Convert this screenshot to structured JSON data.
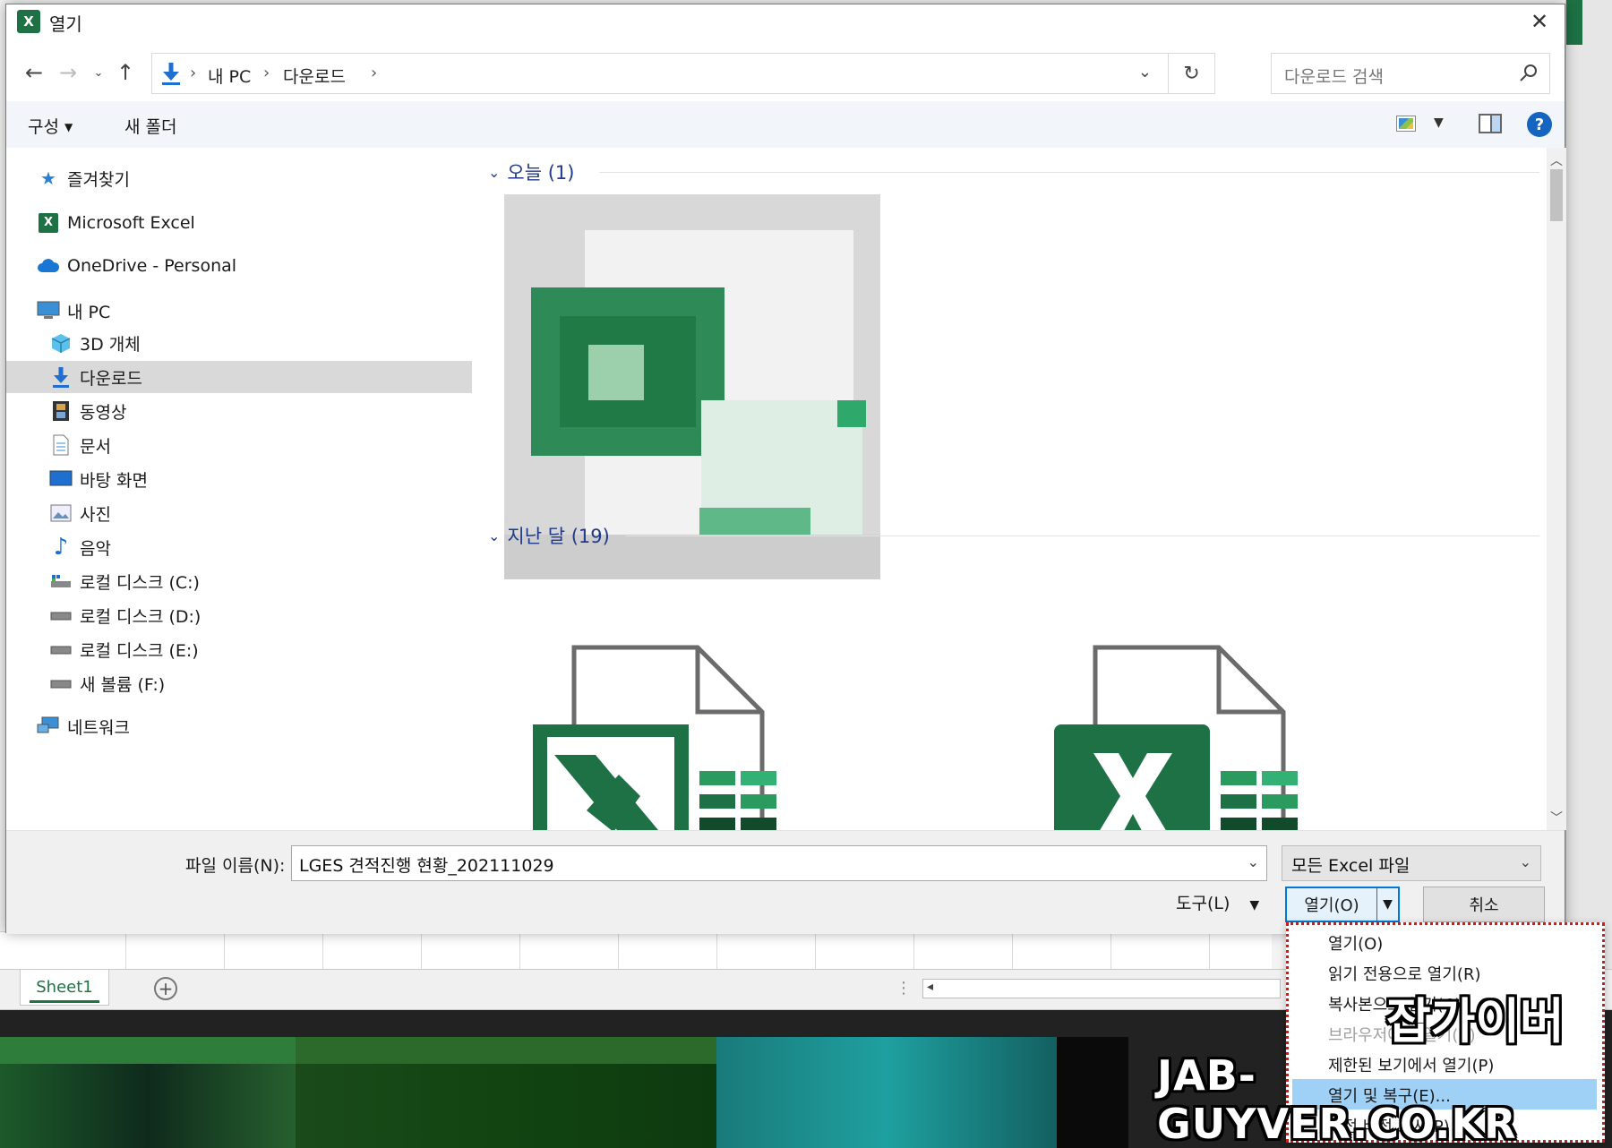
{
  "dialog": {
    "title": "열기",
    "app_icon_letter": "X"
  },
  "nav": {
    "address": [
      "내 PC",
      "다운로드"
    ],
    "search_placeholder": "다운로드 검색"
  },
  "toolbar": {
    "organize_label": "구성",
    "new_folder_label": "새 폴더"
  },
  "sidebar": {
    "items": [
      {
        "label": "즐겨찾기",
        "icon": "star-icon"
      },
      {
        "label": "Microsoft Excel",
        "icon": "excel-icon"
      },
      {
        "label": "OneDrive - Personal",
        "icon": "cloud-icon"
      },
      {
        "label": "내 PC",
        "icon": "computer-icon"
      },
      {
        "label": "3D 개체",
        "icon": "cube-icon"
      },
      {
        "label": "다운로드",
        "icon": "download-icon",
        "selected": true
      },
      {
        "label": "동영상",
        "icon": "film-icon"
      },
      {
        "label": "문서",
        "icon": "document-icon"
      },
      {
        "label": "바탕 화면",
        "icon": "desktop-icon"
      },
      {
        "label": "사진",
        "icon": "picture-icon"
      },
      {
        "label": "음악",
        "icon": "music-icon"
      },
      {
        "label": "로컬 디스크 (C:)",
        "icon": "drive-c-icon"
      },
      {
        "label": "로컬 디스크 (D:)",
        "icon": "drive-icon"
      },
      {
        "label": "로컬 디스크 (E:)",
        "icon": "drive-icon"
      },
      {
        "label": "새 볼륨 (F:)",
        "icon": "drive-icon"
      },
      {
        "label": "네트워크",
        "icon": "network-icon"
      }
    ]
  },
  "content": {
    "groups": [
      {
        "label": "오늘 (1)"
      },
      {
        "label": "지난 달 (19)"
      }
    ]
  },
  "footer": {
    "filename_label": "파일 이름(N):",
    "filename_value": "LGES 견적진행 현황_202111029",
    "filter_value": "모든 Excel 파일",
    "tools_label": "도구(L)",
    "open_label": "열기(O)",
    "cancel_label": "취소"
  },
  "open_menu": {
    "items": [
      {
        "label": "열기(O)"
      },
      {
        "label": "읽기 전용으로 열기(R)"
      },
      {
        "label": "복사본으로 열기(C)"
      },
      {
        "label": "브라우저에서 열기(B)",
        "disabled": true
      },
      {
        "label": "제한된 보기에서 열기(P)"
      },
      {
        "label": "열기 및 복구(E)...",
        "highlighted": true
      },
      {
        "label": "이전 버전 표시(P)"
      }
    ]
  },
  "excel": {
    "sheet_tab": "Sheet1"
  },
  "watermark": {
    "line1": "잡가이버",
    "line2": "JAB-GUYVER.CO.KR"
  },
  "colors": {
    "excel_green": "#1e7145",
    "accent_blue": "#0078d7",
    "group_header": "#1f3a8a",
    "menu_border": "#c81e1e"
  }
}
